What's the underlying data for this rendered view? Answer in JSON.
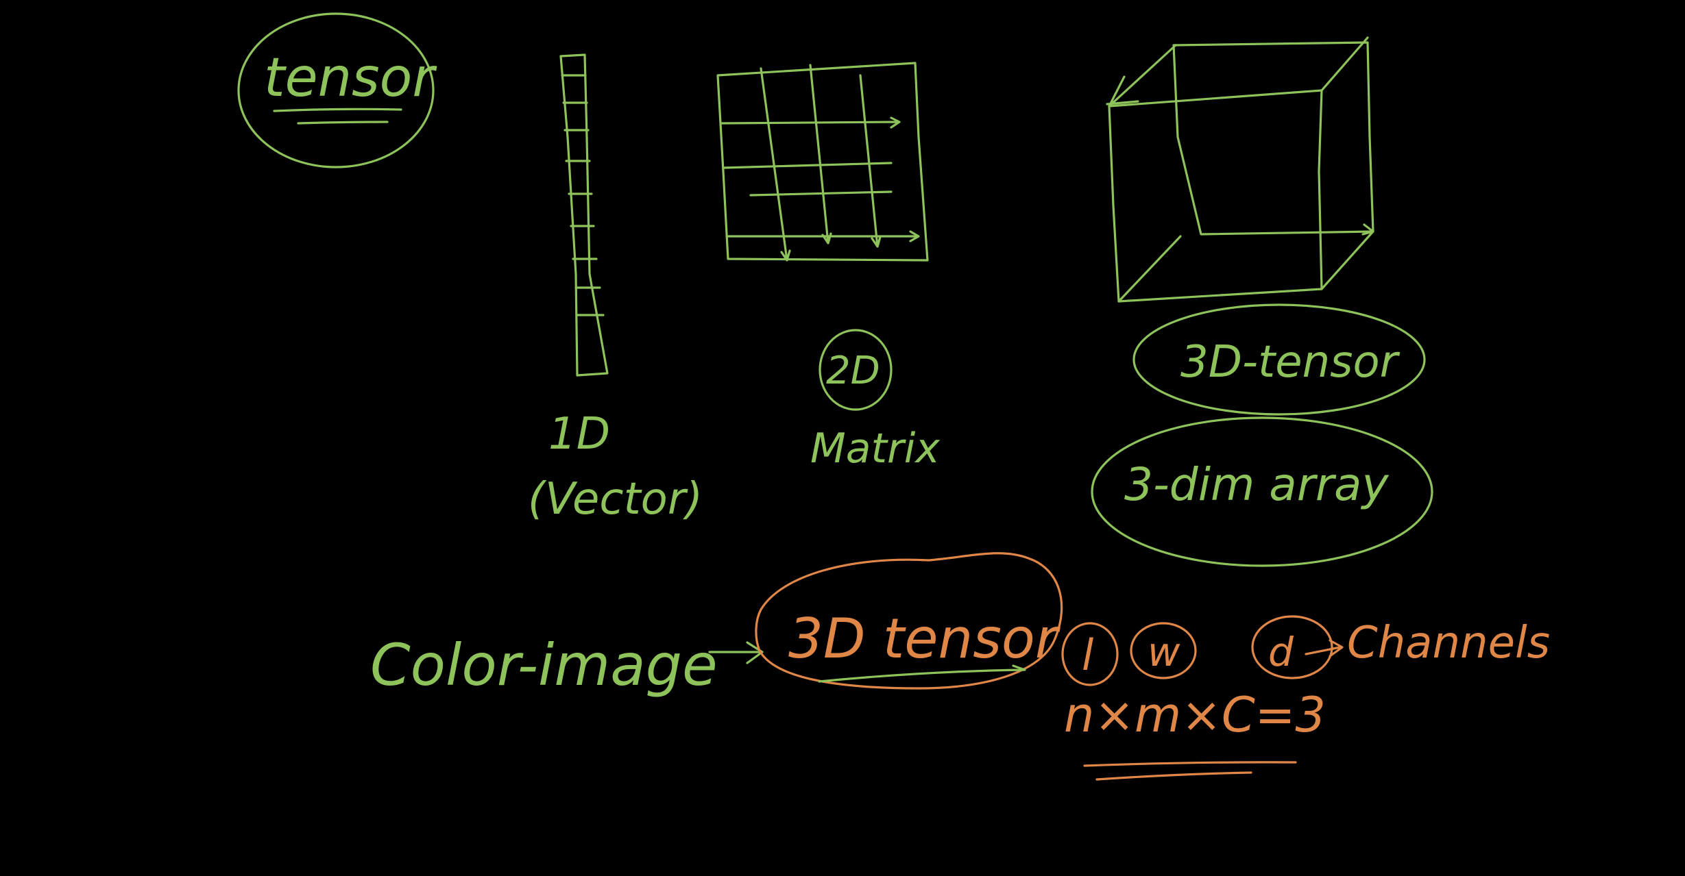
{
  "colors": {
    "background": "#000000",
    "green_ink": "#8ec25a",
    "orange_ink": "#e08748"
  },
  "labels": {
    "tensor": "tensor",
    "one_d": "1D",
    "vector": "(Vector)",
    "two_d": "2D",
    "matrix": "Matrix",
    "three_d_tensor": "3D-tensor",
    "three_dim_array": "3-dim array",
    "color_image": "Color-image",
    "arrow": "→",
    "three_d_tensor_2": "3D tensor",
    "l": "l",
    "w": "w",
    "d": "d",
    "channels": "Channels",
    "formula": "n×m×C=3"
  }
}
